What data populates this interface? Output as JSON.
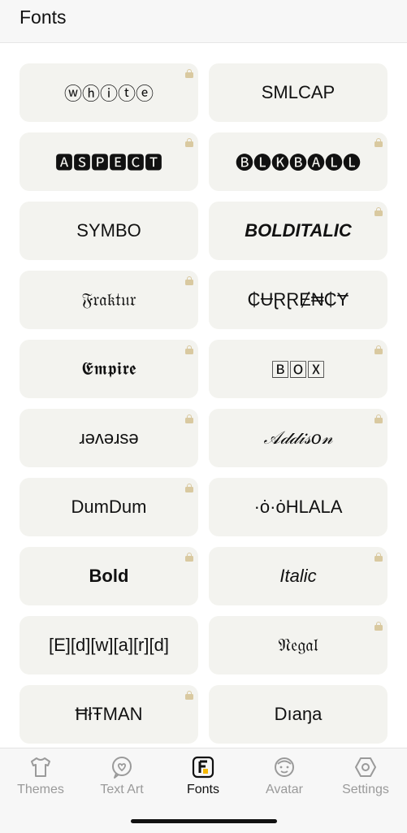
{
  "header": {
    "title": "Fonts"
  },
  "fonts": [
    {
      "label": "ⓦⓗⓘⓣⓔ",
      "locked": true,
      "style": "f-sans"
    },
    {
      "label": "SMLCAP",
      "locked": false,
      "style": "f-sans"
    },
    {
      "label": "🅰🆂🅿🅴🅲🆃",
      "locked": true,
      "style": "f-sans"
    },
    {
      "label": "🅑🅛🅚🅑🅐🅛🅛",
      "locked": true,
      "style": "f-sans"
    },
    {
      "label": "SYMBO",
      "locked": false,
      "style": "f-sans"
    },
    {
      "label": "BOLDITALIC",
      "locked": true,
      "style": "f-sans bold italic"
    },
    {
      "label": "𝔉𝔯𝔞𝔨𝔱𝔲𝔯",
      "locked": true,
      "style": "f-serif"
    },
    {
      "label": "₵ɄⱤⱤɆ₦₵Ɏ",
      "locked": false,
      "style": "f-sans"
    },
    {
      "label": "𝕰𝖒𝖕𝖎𝖗𝖊",
      "locked": true,
      "style": "f-serif"
    },
    {
      "label": "🄱🄾🅇",
      "locked": true,
      "style": "f-sans"
    },
    {
      "label": "ɹəʌəɹsə",
      "locked": true,
      "style": "f-sans"
    },
    {
      "label": "𝒜𝒹𝒹𝒾𝓈𝑜𝓃",
      "locked": true,
      "style": "f-serif italic"
    },
    {
      "label": "DumDum",
      "locked": true,
      "style": "f-sans"
    },
    {
      "label": "·ȯ·ȯHLALA",
      "locked": false,
      "style": "f-sans"
    },
    {
      "label": "Bold",
      "locked": true,
      "style": "f-sans bold"
    },
    {
      "label": "Italic",
      "locked": true,
      "style": "f-sans italic"
    },
    {
      "label": "[E][d][w][a][r][d]",
      "locked": false,
      "style": "f-sans"
    },
    {
      "label": "𝔑𝔢𝔤𝔞𝔩",
      "locked": true,
      "style": "f-serif"
    },
    {
      "label": "ĦłŦMAN",
      "locked": true,
      "style": "f-sans"
    },
    {
      "label": "Dıaŋa",
      "locked": false,
      "style": "f-sans"
    }
  ],
  "tabs": [
    {
      "label": "Themes",
      "icon": "tshirt-icon",
      "active": false
    },
    {
      "label": "Text Art",
      "icon": "heart-bubble-icon",
      "active": false
    },
    {
      "label": "Fonts",
      "icon": "font-f-icon",
      "active": true
    },
    {
      "label": "Avatar",
      "icon": "face-icon",
      "active": false
    },
    {
      "label": "Settings",
      "icon": "hexagon-gear-icon",
      "active": false
    }
  ],
  "colors": {
    "card_bg": "#f3f3ef",
    "lock": "#d9c9a0",
    "active_tab": "#111111",
    "inactive_tab": "#9a9a9a"
  }
}
